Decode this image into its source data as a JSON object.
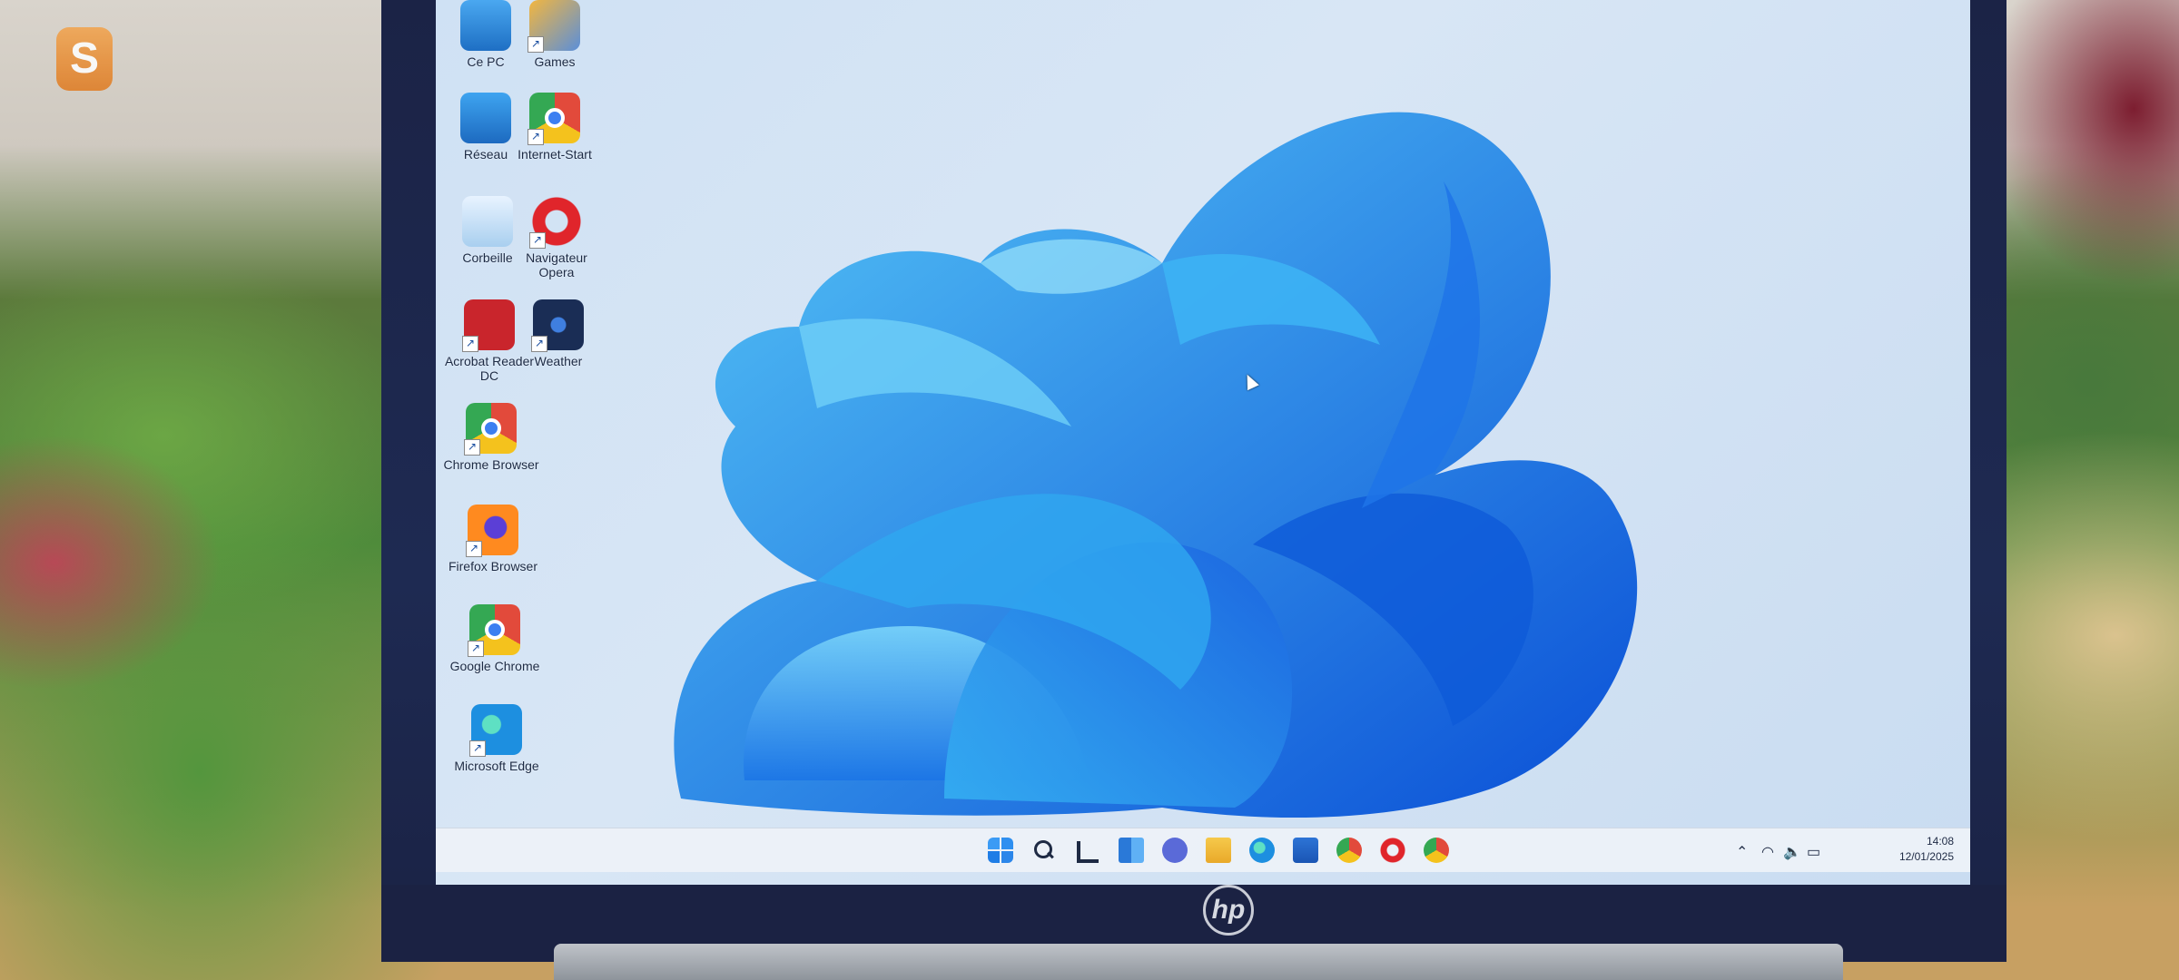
{
  "desktop": {
    "icons": [
      {
        "id": "ce-pc",
        "label": "Ce PC",
        "icon": "computer-icon",
        "shortcut": false
      },
      {
        "id": "games",
        "label": "Games",
        "icon": "games-icon",
        "shortcut": true
      },
      {
        "id": "reseau",
        "label": "Réseau",
        "icon": "network-icon",
        "shortcut": false
      },
      {
        "id": "internet-start",
        "label": "Internet-Start",
        "icon": "chrome-variant-icon",
        "shortcut": true
      },
      {
        "id": "corbeille",
        "label": "Corbeille",
        "icon": "recycle-bin-icon",
        "shortcut": false
      },
      {
        "id": "opera",
        "label": "Navigateur Opera",
        "icon": "opera-icon",
        "shortcut": true
      },
      {
        "id": "acrobat",
        "label": "Acrobat Reader DC",
        "icon": "acrobat-icon",
        "shortcut": true
      },
      {
        "id": "weather",
        "label": "Weather",
        "icon": "weather-icon",
        "shortcut": true
      },
      {
        "id": "chrome-browser",
        "label": "Chrome Browser",
        "icon": "chrome-variant-icon",
        "shortcut": true
      },
      {
        "id": "firefox",
        "label": "Firefox Browser",
        "icon": "firefox-icon",
        "shortcut": true
      },
      {
        "id": "google-chrome",
        "label": "Google Chrome",
        "icon": "chrome-icon",
        "shortcut": true
      },
      {
        "id": "edge",
        "label": "Microsoft Edge",
        "icon": "edge-icon",
        "shortcut": true
      }
    ]
  },
  "taskbar": {
    "pinned": [
      "start-icon",
      "search-icon",
      "task-view-icon",
      "widgets-icon",
      "chat-icon",
      "file-explorer-icon",
      "edge-icon",
      "store-icon",
      "chrome-icon",
      "opera-icon",
      "chrome-variant-icon"
    ],
    "tray": {
      "icons": [
        "chevron-up-icon",
        "wifi-icon",
        "volume-icon",
        "battery-icon"
      ],
      "time": "14:08",
      "date": "12/01/2025"
    }
  },
  "laptop": {
    "brand": "hp"
  }
}
